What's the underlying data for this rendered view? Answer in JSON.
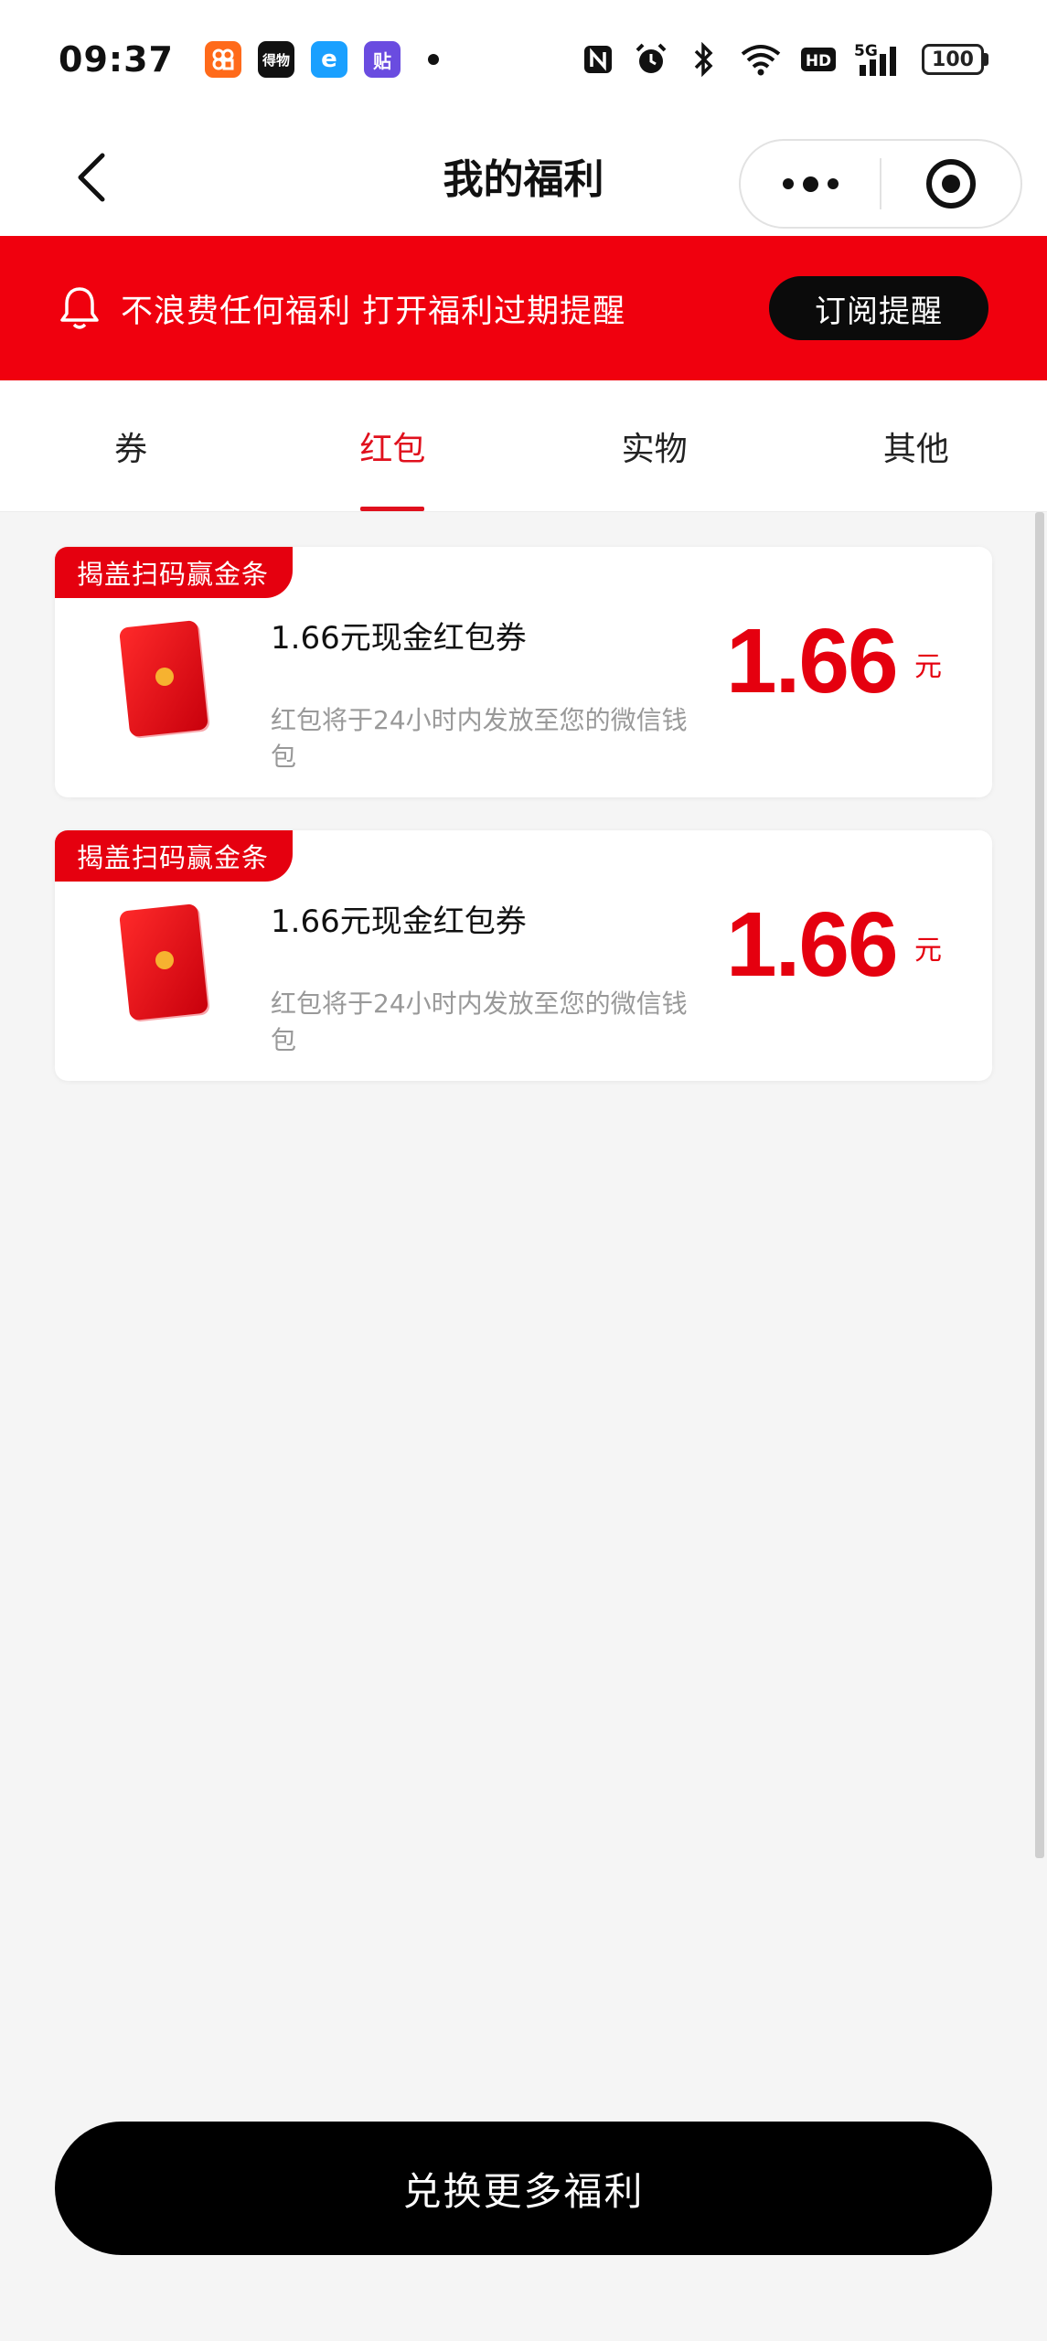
{
  "status_bar": {
    "time": "09:37",
    "apps": [
      {
        "icon": "app-orange-icon",
        "label": "",
        "color": "#ff6a1a"
      },
      {
        "icon": "app-dewu-icon",
        "label": "得物",
        "color": "#111111"
      },
      {
        "icon": "app-eleme-icon",
        "label": "e",
        "color": "#1aa0ff"
      },
      {
        "icon": "app-tie-icon",
        "label": "贴",
        "color": "#6a4ce0"
      }
    ],
    "battery": "100",
    "network": "5G",
    "hd_label": "HD",
    "nfc_label": "N"
  },
  "nav": {
    "title": "我的福利"
  },
  "banner": {
    "text": "不浪费任何福利 打开福利过期提醒",
    "button": "订阅提醒",
    "color": "#f0000e"
  },
  "tabs": [
    {
      "label": "券",
      "active": false
    },
    {
      "label": "红包",
      "active": true
    },
    {
      "label": "实物",
      "active": false
    },
    {
      "label": "其他",
      "active": false
    }
  ],
  "cards": [
    {
      "tag": "揭盖扫码赢金条",
      "title": "1.66元现金红包券",
      "description": "红包将于24小时内发放至您的微信钱包",
      "amount": "1.66",
      "unit": "元"
    },
    {
      "tag": "揭盖扫码赢金条",
      "title": "1.66元现金红包券",
      "description": "红包将于24小时内发放至您的微信钱包",
      "amount": "1.66",
      "unit": "元"
    }
  ],
  "bottom_button": "兑换更多福利",
  "accent_color": "#e5000f"
}
